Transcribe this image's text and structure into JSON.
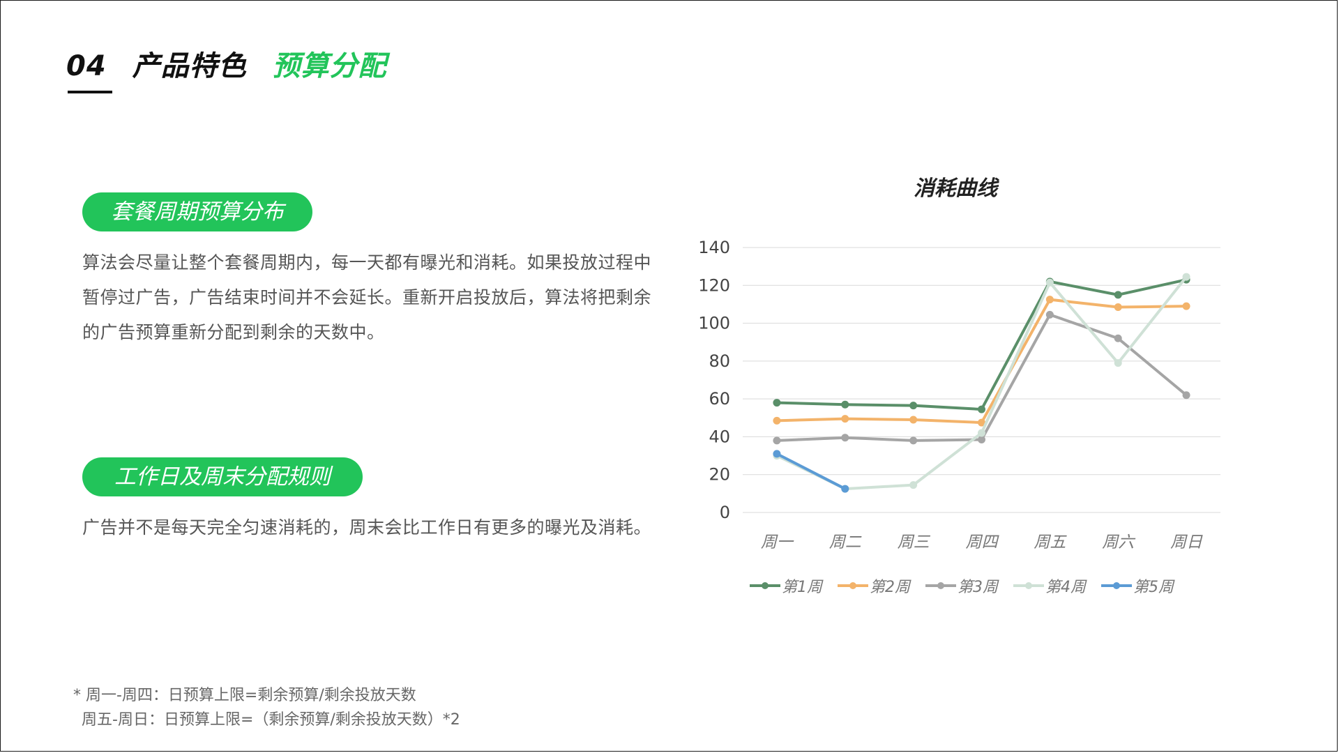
{
  "header": {
    "number": "04",
    "title": "产品特色",
    "subtitle": "预算分配"
  },
  "sections": [
    {
      "pill": "套餐周期预算分布",
      "text": "算法会尽量让整个套餐周期内，每一天都有曝光和消耗。如果投放过程中暂停过广告，广告结束时间并不会延长。重新开启投放后，算法将把剩余的广告预算重新分配到剩余的天数中。"
    },
    {
      "pill": "工作日及周末分配规则",
      "text": "广告并不是每天完全匀速消耗的，周末会比工作日有更多的曝光及消耗。"
    }
  ],
  "footnote": {
    "line1": "* 周一-周四：日预算上限=剩余预算/剩余投放天数",
    "line2": "周五-周日：日预算上限=（剩余预算/剩余投放天数）*2"
  },
  "colors": {
    "accent": "#22c45a",
    "text": "#555555"
  },
  "chart_data": {
    "type": "line",
    "title": "消耗曲线",
    "categories": [
      "周一",
      "周二",
      "周三",
      "周四",
      "周五",
      "周六",
      "周日"
    ],
    "ylim": [
      0,
      140
    ],
    "yticks": [
      0,
      20,
      40,
      60,
      80,
      100,
      120,
      140
    ],
    "grid": true,
    "legend_position": "bottom",
    "series": [
      {
        "name": "第1周",
        "color": "#5a8f69",
        "values": [
          58,
          57,
          56.5,
          54.5,
          122,
          115,
          123
        ]
      },
      {
        "name": "第2周",
        "color": "#f3b36a",
        "values": [
          48.5,
          49.5,
          49,
          47.5,
          112.5,
          108.5,
          109
        ]
      },
      {
        "name": "第3周",
        "color": "#a5a5a5",
        "values": [
          38,
          39.5,
          38,
          38.5,
          104.5,
          92,
          62
        ]
      },
      {
        "name": "第4周",
        "color": "#cfe1d6",
        "values": [
          30,
          12.5,
          14.5,
          42,
          121.5,
          79,
          124.5
        ]
      },
      {
        "name": "第5周",
        "color": "#5b9bd5",
        "values": [
          31,
          12.5,
          null,
          null,
          null,
          null,
          null
        ]
      }
    ]
  }
}
